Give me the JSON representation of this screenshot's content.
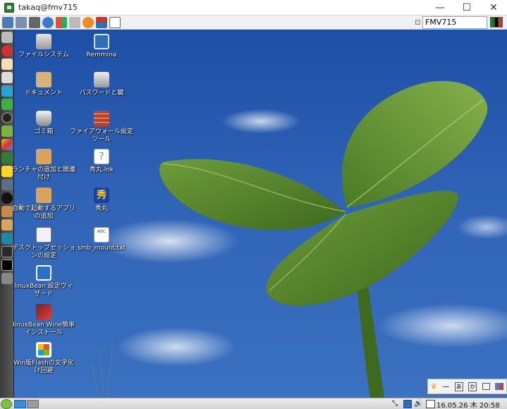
{
  "window": {
    "title": "takaq@fmv715",
    "minimize": "—",
    "maximize": "☐",
    "close": "✕"
  },
  "toolbar": {
    "host_field_value": "FMV715",
    "buttons": [
      "display-icon",
      "connections-icon",
      "tools-icon",
      "refresh-icon",
      "windows-key-icon",
      "keyboard-icon",
      "info-icon",
      "transfer-icon",
      "fullscreen-icon"
    ]
  },
  "desktop": {
    "icons_col1": [
      {
        "label": "ファイルシステム",
        "icon": "drive-icon"
      },
      {
        "label": "ドキュメント",
        "icon": "folder-icon"
      },
      {
        "label": "ゴミ箱",
        "icon": "trash-icon"
      },
      {
        "label": "ランチャの追加と関連付け",
        "icon": "launcher-settings-icon"
      },
      {
        "label": "自動で起動するアプリの追加",
        "icon": "autostart-settings-icon"
      },
      {
        "label": "デスクトップセッションの設定",
        "icon": "session-settings-icon"
      },
      {
        "label": "linuxBean 設定ウィザード",
        "icon": "wizard-icon"
      },
      {
        "label": "linuxBean Wine簡単インストール",
        "icon": "wine-icon"
      },
      {
        "label": "Win版Flashの文字化け回避",
        "icon": "windows-flag-icon"
      }
    ],
    "icons_col2": [
      {
        "label": "Remmina",
        "icon": "remote-desktop-icon"
      },
      {
        "label": "パスワードと鍵",
        "icon": "keyring-icon"
      },
      {
        "label": "ファイアウォール設定ツール",
        "icon": "firewall-icon"
      },
      {
        "label": "秀丸.lnk",
        "icon": "unknown-file-icon"
      },
      {
        "label": "秀丸",
        "icon": "hidemaru-icon"
      },
      {
        "label": "smb_mount.txt",
        "icon": "text-file-icon"
      }
    ]
  },
  "launcher": {
    "items": [
      "files-icon",
      "opera-icon",
      "notes-icon",
      "pen-icon",
      "network-icon",
      "terminal-green-icon",
      "media-icon",
      "game-icon",
      "paint-icon",
      "image-viewer-icon",
      "bird-icon",
      "wifi-icon",
      "settings-icon",
      "box-icon",
      "archive-icon",
      "antenna-icon",
      "monitor-icon",
      "console-icon",
      "disk-icon"
    ]
  },
  "tray_panel": {
    "items": [
      "crown-icon",
      "minus-icon",
      "input-method-icon",
      "kana-icon",
      "dictionary-icon",
      "pen-tablet-icon"
    ],
    "kana_label": "か"
  },
  "taskbar": {
    "clock": "16.05.26 木 20:58"
  },
  "colors": {
    "sky_top": "#1d4fa6",
    "leaf_green": "#5a8a2e",
    "launcher_bg": "#3a3a3a",
    "taskbar_bg": "#e0e0e0"
  }
}
